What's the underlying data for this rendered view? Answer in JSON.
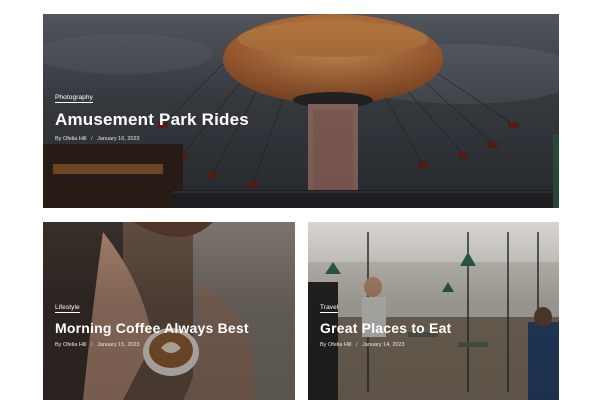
{
  "posts": [
    {
      "category": "Photography",
      "title": "Amusement Park Rides",
      "author": "By Ofelia Hill",
      "separator": "/",
      "date": "January 16, 2023",
      "image": "swing-carousel-photo"
    },
    {
      "category": "Lifestyle",
      "title": "Morning Coffee Always Best",
      "author": "By Ofelia Hill",
      "separator": "/",
      "date": "January 15, 2023",
      "image": "latte-art-photo"
    },
    {
      "category": "Travel",
      "title": "Great Places to Eat",
      "author": "By Ofelia Hill",
      "separator": "/",
      "date": "January 14, 2023",
      "image": "cafe-interior-photo"
    }
  ],
  "colors": {
    "overlay": "#000000",
    "text": "#ffffff",
    "background": "#ffffff"
  }
}
